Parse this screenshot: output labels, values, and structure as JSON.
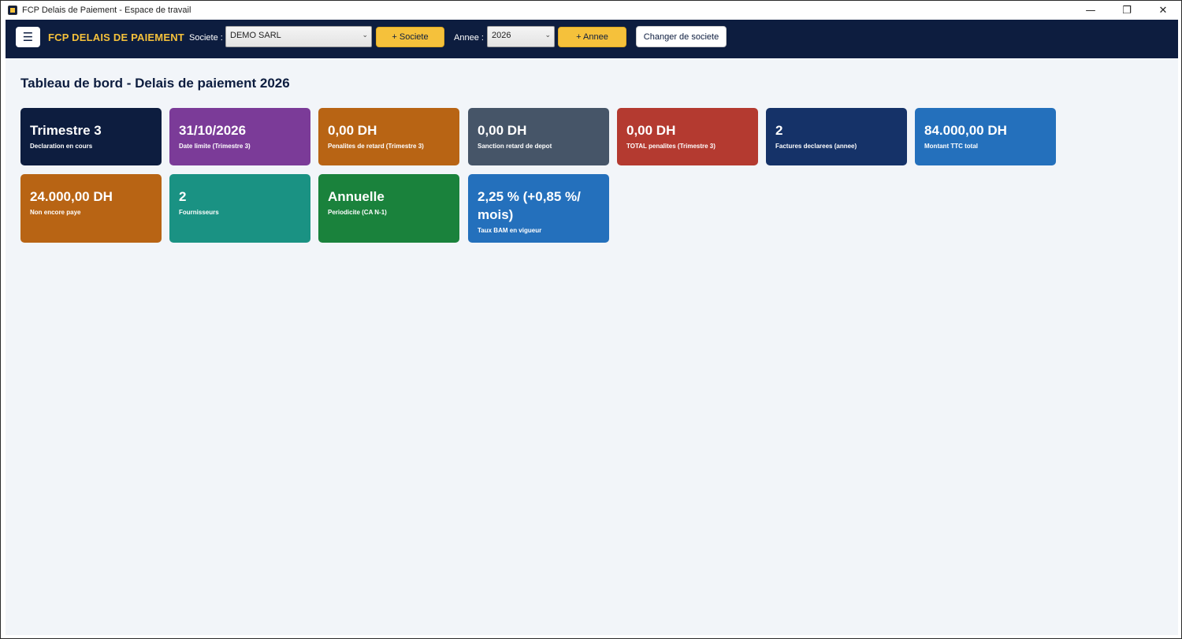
{
  "window": {
    "title": "FCP Delais de Paiement - Espace de travail",
    "controls": {
      "minimize": "—",
      "restore": "❐",
      "close": "✕"
    }
  },
  "header": {
    "menu_icon": "☰",
    "brand": "FCP DELAIS DE PAIEMENT",
    "societe_label": "Societe :",
    "societe_value": "DEMO SARL",
    "add_societe": "+ Societe",
    "annee_label": "Annee :",
    "annee_value": "2026",
    "add_annee": "+ Annee",
    "change_societe": "Changer de societe",
    "chevron": "⌄"
  },
  "dashboard": {
    "title": "Tableau de bord - Delais de paiement 2026",
    "cards": [
      {
        "value": "Trimestre 3",
        "desc": "Declaration en cours",
        "color": "#0d1d3f"
      },
      {
        "value": "31/10/2026",
        "desc": "Date limite (Trimestre 3)",
        "color": "#7b3b98"
      },
      {
        "value": "0,00 DH",
        "desc": "Penalites de retard (Trimestre 3)",
        "color": "#b86414"
      },
      {
        "value": "0,00 DH",
        "desc": "Sanction retard de depot",
        "color": "#465568"
      },
      {
        "value": "0,00 DH",
        "desc": "TOTAL penalites (Trimestre 3)",
        "color": "#b43a30"
      },
      {
        "value": "2",
        "desc": "Factures declarees (annee)",
        "color": "#153268"
      },
      {
        "value": "84.000,00 DH",
        "desc": "Montant TTC total",
        "color": "#2470bc"
      },
      {
        "value": "24.000,00 DH",
        "desc": "Non encore paye",
        "color": "#b86414"
      },
      {
        "value": "2",
        "desc": "Fournisseurs",
        "color": "#1a9283"
      },
      {
        "value": "Annuelle",
        "desc": "Periodicite (CA N-1)",
        "color": "#1a823c"
      },
      {
        "value": "2,25 %  (+0,85 %/ mois)",
        "desc": "Taux BAM en vigueur",
        "color": "#2470bc"
      }
    ]
  }
}
